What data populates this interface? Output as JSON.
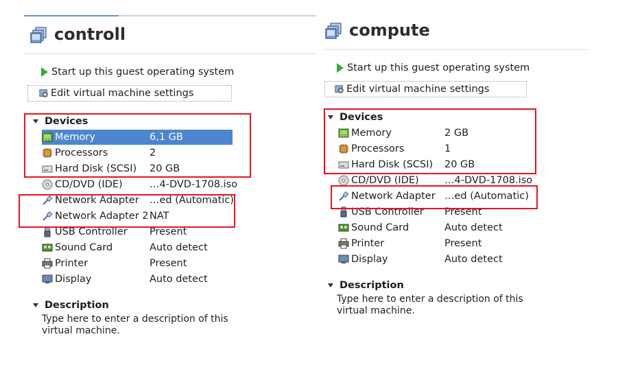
{
  "left": {
    "title": "controll",
    "actions": {
      "start": "Start up this guest operating system",
      "edit": "Edit virtual machine settings"
    },
    "devices_header": "Devices",
    "devices": [
      {
        "name": "Memory",
        "value": "6,1 GB",
        "icon": "memory-icon"
      },
      {
        "name": "Processors",
        "value": "2",
        "icon": "processor-icon"
      },
      {
        "name": "Hard Disk (SCSI)",
        "value": "20 GB",
        "icon": "hard-disk-icon"
      },
      {
        "name": "CD/DVD (IDE)",
        "value": "…4-DVD-1708.iso",
        "icon": "cd-dvd-icon"
      },
      {
        "name": "Network Adapter",
        "value": "…ed (Automatic)",
        "icon": "network-adapter-icon"
      },
      {
        "name": "Network Adapter 2",
        "value": "NAT",
        "icon": "network-adapter-icon"
      },
      {
        "name": "USB Controller",
        "value": "Present",
        "icon": "usb-icon"
      },
      {
        "name": "Sound Card",
        "value": "Auto detect",
        "icon": "sound-card-icon"
      },
      {
        "name": "Printer",
        "value": "Present",
        "icon": "printer-icon"
      },
      {
        "name": "Display",
        "value": "Auto detect",
        "icon": "display-icon"
      }
    ],
    "selected_device": "Memory",
    "description_header": "Description",
    "description_line1": "Type here to enter a description of this",
    "description_line2": "virtual machine."
  },
  "right": {
    "title": "compute",
    "actions": {
      "start": "Start up this guest operating system",
      "edit": "Edit virtual machine settings"
    },
    "devices_header": "Devices",
    "devices": [
      {
        "name": "Memory",
        "value": "2 GB",
        "icon": "memory-icon"
      },
      {
        "name": "Processors",
        "value": "1",
        "icon": "processor-icon"
      },
      {
        "name": "Hard Disk (SCSI)",
        "value": "20 GB",
        "icon": "hard-disk-icon"
      },
      {
        "name": "CD/DVD (IDE)",
        "value": "…4-DVD-1708.iso",
        "icon": "cd-dvd-icon"
      },
      {
        "name": "Network Adapter",
        "value": "…ed (Automatic)",
        "icon": "network-adapter-icon"
      },
      {
        "name": "USB Controller",
        "value": "Present",
        "icon": "usb-icon"
      },
      {
        "name": "Sound Card",
        "value": "Auto detect",
        "icon": "sound-card-icon"
      },
      {
        "name": "Printer",
        "value": "Present",
        "icon": "printer-icon"
      },
      {
        "name": "Display",
        "value": "Auto detect",
        "icon": "display-icon"
      }
    ],
    "description_header": "Description",
    "description_line1": "Type here to enter a description of this",
    "description_line2": "virtual machine."
  },
  "colors": {
    "selection": "#4d85d1",
    "highlight_box": "#e8141d",
    "play_icon": "#3aa63a",
    "tab_accent": "#5f95cf"
  }
}
